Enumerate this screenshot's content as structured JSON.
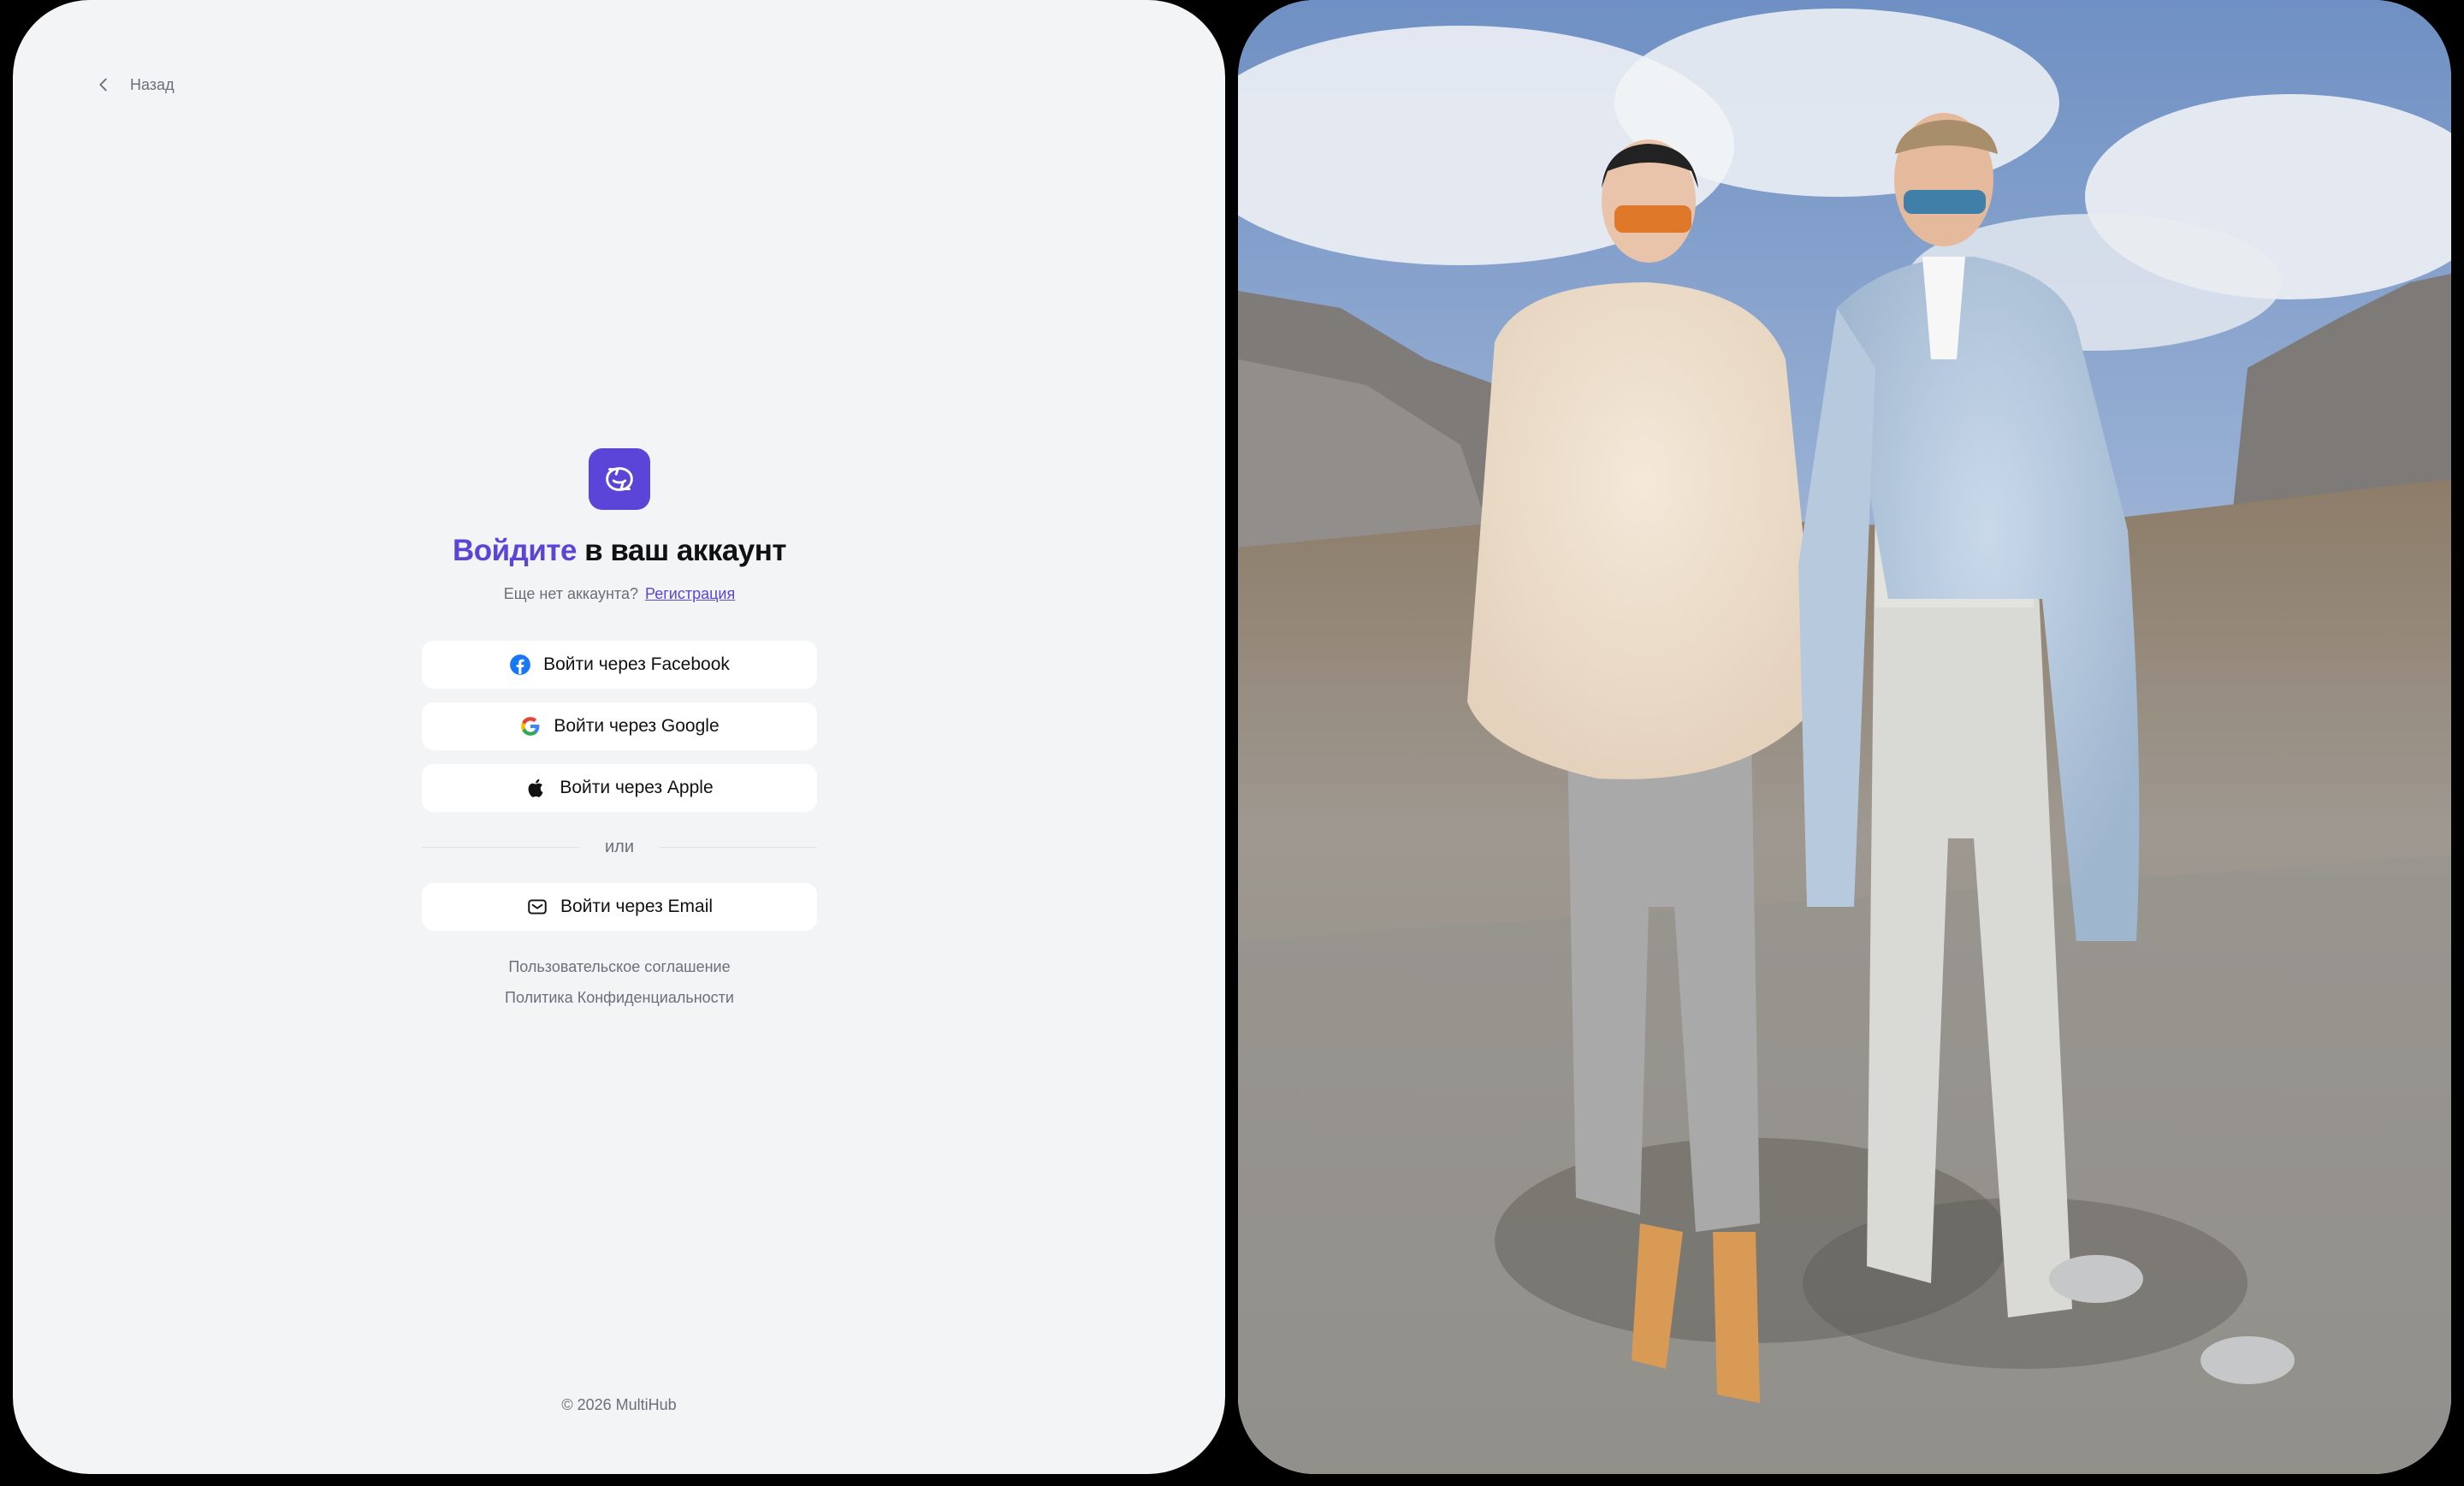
{
  "back": {
    "label": "Назад"
  },
  "login": {
    "title_accent": "Войдите",
    "title_rest": " в ваш аккаунт",
    "no_account": "Еще нет аккаунта?",
    "register_link": "Регистрация",
    "buttons": {
      "facebook": "Войти через Facebook",
      "google": "Войти через Google",
      "apple": "Войти через Apple",
      "email": "Войти через Email"
    },
    "divider": "или",
    "terms": "Пользовательское соглашение",
    "privacy": "Политика Конфиденциальности"
  },
  "footer": {
    "copyright": "© 2026 MultiHub"
  },
  "colors": {
    "accent": "#5a46d6",
    "background": "#f3f4f6",
    "facebook": "#1877f2"
  },
  "icons": [
    "chevron-left-icon",
    "app-logo-icon",
    "facebook-icon",
    "google-icon",
    "apple-icon",
    "mail-icon"
  ]
}
